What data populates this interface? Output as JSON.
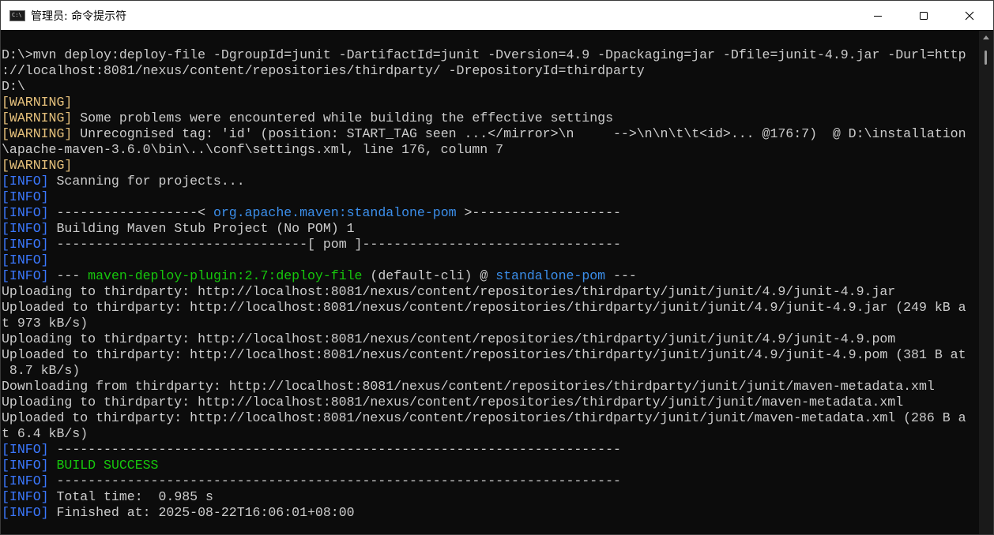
{
  "window": {
    "title": "管理员: 命令提示符"
  },
  "lines": [
    [
      {
        "t": "D:\\>mvn deploy:deploy-file -DgroupId=junit -DartifactId=junit -Dversion=4.9 -Dpackaging=jar -Dfile=junit-4.9.jar -Durl=http"
      }
    ],
    [
      {
        "t": "://localhost:8081/nexus/content/repositories/thirdparty/ -DrepositoryId=thirdparty"
      }
    ],
    [
      {
        "t": "D:\\"
      }
    ],
    [
      {
        "t": "[WARNING]",
        "c": "warn"
      }
    ],
    [
      {
        "t": "[WARNING]",
        "c": "warn"
      },
      {
        "t": " Some problems were encountered while building the effective settings"
      }
    ],
    [
      {
        "t": "[WARNING]",
        "c": "warn"
      },
      {
        "t": " Unrecognised tag: 'id' (position: START_TAG seen ...</mirror>\\n     -->\\n\\n\\t\\t<id>... @176:7)  @ D:\\installation"
      }
    ],
    [
      {
        "t": "\\apache-maven-3.6.0\\bin\\..\\conf\\settings.xml, line 176, column 7"
      }
    ],
    [
      {
        "t": "[WARNING]",
        "c": "warn"
      }
    ],
    [
      {
        "t": "[INFO]",
        "c": "info"
      },
      {
        "t": " Scanning for projects..."
      }
    ],
    [
      {
        "t": "[INFO]",
        "c": "info"
      }
    ],
    [
      {
        "t": "[INFO]",
        "c": "info"
      },
      {
        "t": " ------------------< "
      },
      {
        "t": "org.apache.maven:standalone-pom",
        "c": "blu"
      },
      {
        "t": " >-------------------"
      }
    ],
    [
      {
        "t": "[INFO]",
        "c": "info"
      },
      {
        "t": " Building Maven Stub Project (No POM) 1"
      }
    ],
    [
      {
        "t": "[INFO]",
        "c": "info"
      },
      {
        "t": " --------------------------------[ pom ]---------------------------------"
      }
    ],
    [
      {
        "t": "[INFO]",
        "c": "info"
      }
    ],
    [
      {
        "t": "[INFO]",
        "c": "info"
      },
      {
        "t": " --- "
      },
      {
        "t": "maven-deploy-plugin:2.7:deploy-file",
        "c": "grn"
      },
      {
        "t": " (default-cli) @ "
      },
      {
        "t": "standalone-pom",
        "c": "blu"
      },
      {
        "t": " ---"
      }
    ],
    [
      {
        "t": "Uploading to thirdparty: http://localhost:8081/nexus/content/repositories/thirdparty/junit/junit/4.9/junit-4.9.jar"
      }
    ],
    [
      {
        "t": "Uploaded to thirdparty: http://localhost:8081/nexus/content/repositories/thirdparty/junit/junit/4.9/junit-4.9.jar (249 kB a"
      }
    ],
    [
      {
        "t": "t 973 kB/s)"
      }
    ],
    [
      {
        "t": "Uploading to thirdparty: http://localhost:8081/nexus/content/repositories/thirdparty/junit/junit/4.9/junit-4.9.pom"
      }
    ],
    [
      {
        "t": "Uploaded to thirdparty: http://localhost:8081/nexus/content/repositories/thirdparty/junit/junit/4.9/junit-4.9.pom (381 B at"
      }
    ],
    [
      {
        "t": " 8.7 kB/s)"
      }
    ],
    [
      {
        "t": "Downloading from thirdparty: http://localhost:8081/nexus/content/repositories/thirdparty/junit/junit/maven-metadata.xml"
      }
    ],
    [
      {
        "t": "Uploading to thirdparty: http://localhost:8081/nexus/content/repositories/thirdparty/junit/junit/maven-metadata.xml"
      }
    ],
    [
      {
        "t": "Uploaded to thirdparty: http://localhost:8081/nexus/content/repositories/thirdparty/junit/junit/maven-metadata.xml (286 B a"
      }
    ],
    [
      {
        "t": "t 6.4 kB/s)"
      }
    ],
    [
      {
        "t": "[INFO]",
        "c": "info"
      },
      {
        "t": " ------------------------------------------------------------------------"
      }
    ],
    [
      {
        "t": "[INFO]",
        "c": "info"
      },
      {
        "t": " "
      },
      {
        "t": "BUILD SUCCESS",
        "c": "grn"
      }
    ],
    [
      {
        "t": "[INFO]",
        "c": "info"
      },
      {
        "t": " ------------------------------------------------------------------------"
      }
    ],
    [
      {
        "t": "[INFO]",
        "c": "info"
      },
      {
        "t": " Total time:  0.985 s"
      }
    ],
    [
      {
        "t": "[INFO]",
        "c": "info"
      },
      {
        "t": " Finished at: 2025-08-22T16:06:01+08:00"
      }
    ]
  ]
}
